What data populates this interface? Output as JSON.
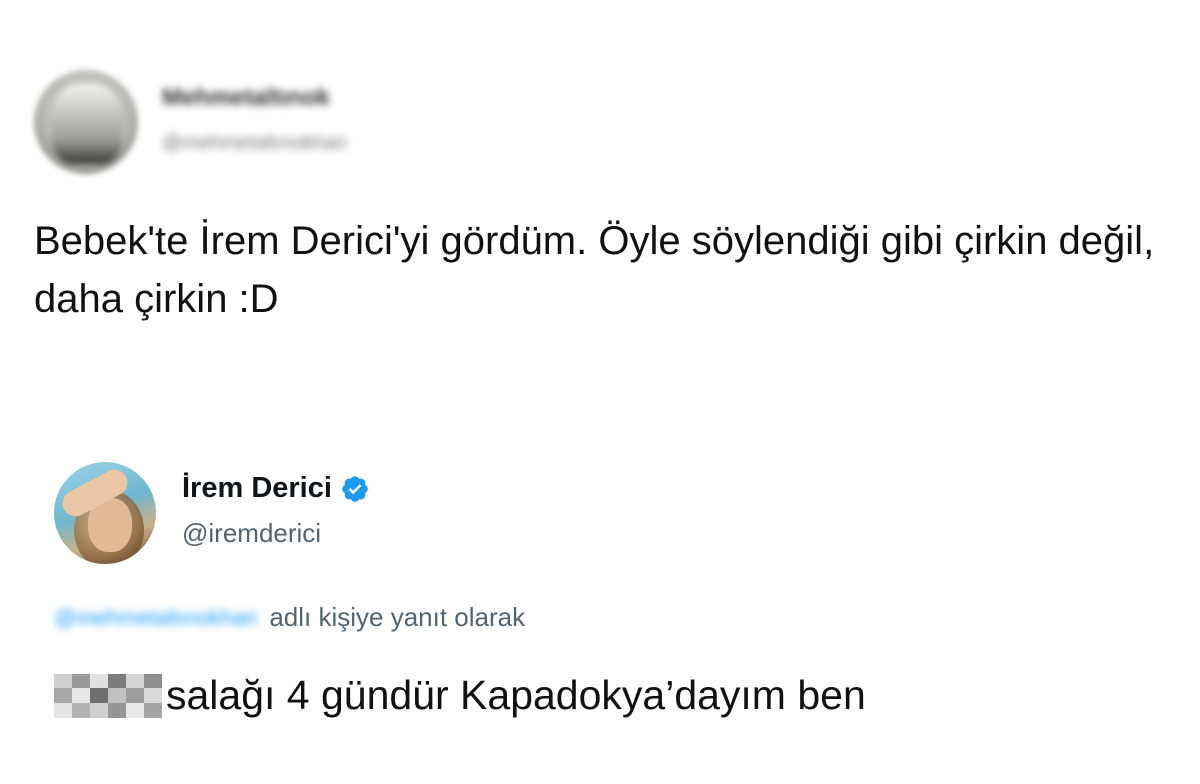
{
  "tweet1": {
    "author": {
      "name": "Mehmetaltınok",
      "handle": "@mehmetaltınokhan"
    },
    "text": "Bebek'te İrem Derici'yi gördüm. Öyle söylendiği gibi çirkin değil, daha çirkin :D"
  },
  "tweet2": {
    "author": {
      "name": "İrem Derici",
      "handle": "@iremderici",
      "verified": true
    },
    "replying_to_handle": "@mehmetaltınokhan",
    "replying_to_suffix": "adlı kişiye yanıt olarak",
    "text": "salağı 4 gündür Kapadokya’dayım ben"
  },
  "colors": {
    "verified_badge": "#1d9bf0",
    "handle_gray": "#536471",
    "link_blue": "#1d9bf0"
  },
  "icons": {
    "verified": "verified-badge-icon"
  }
}
